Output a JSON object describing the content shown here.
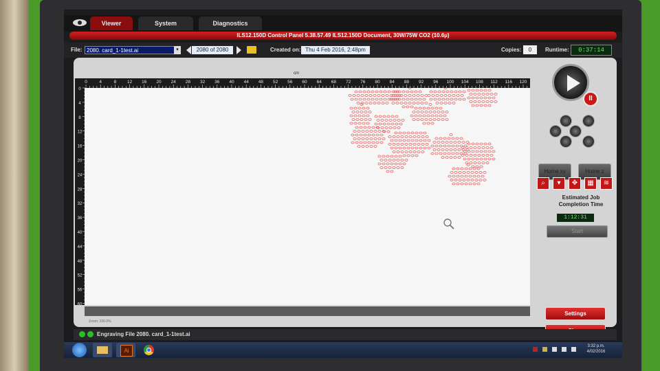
{
  "tabs": [
    {
      "label": "Viewer"
    },
    {
      "label": "System"
    },
    {
      "label": "Diagnostics"
    }
  ],
  "title_bar": "ILS12.150D  Control Panel  5.38.57.49    ILS12.150D Document, 30W/75W CO2 (10.6µ)",
  "file": {
    "label": "File:",
    "value": "2080. card_1-1test.ai",
    "count": "2080 of 2080"
  },
  "created": {
    "label": "Created on:",
    "value": "Thu 4 Feb 2016,  2:48pm"
  },
  "copies": {
    "label": "Copies:",
    "value": "0"
  },
  "runtime": {
    "label": "Runtime:",
    "value": "0:37:14"
  },
  "ruler": {
    "unit": "cm",
    "top_ticks": [
      "0",
      "4",
      "8",
      "12",
      "16",
      "20",
      "24",
      "28",
      "32",
      "36",
      "40",
      "44",
      "48",
      "52",
      "56",
      "60",
      "64",
      "68",
      "72",
      "76",
      "80",
      "84",
      "88",
      "92",
      "96",
      "100",
      "104",
      "108",
      "112",
      "116",
      "120"
    ],
    "left_ticks": [
      "0",
      "4",
      "8",
      "12",
      "16",
      "20",
      "24",
      "28",
      "32",
      "36",
      "40",
      "44",
      "48",
      "52",
      "56",
      "60"
    ]
  },
  "zoom": "Zoom: 100.0%",
  "controls": {
    "pause_label": "II",
    "home_xy": "Home xy",
    "home_z": "Home z",
    "estimate_label": "Estimated Job Completion Time",
    "estimate_value": "1:12:31",
    "start": "Start",
    "settings": "Settings",
    "close": "Close"
  },
  "status": "Engraving File 2080. card_1-1test.ai",
  "taskbar": {
    "time": "3:32 p.m.",
    "date": "4/02/2016"
  },
  "colors": {
    "accent_red": "#c01818",
    "engrave_pink": "#e25a5a",
    "lcd_green": "#60f060"
  }
}
